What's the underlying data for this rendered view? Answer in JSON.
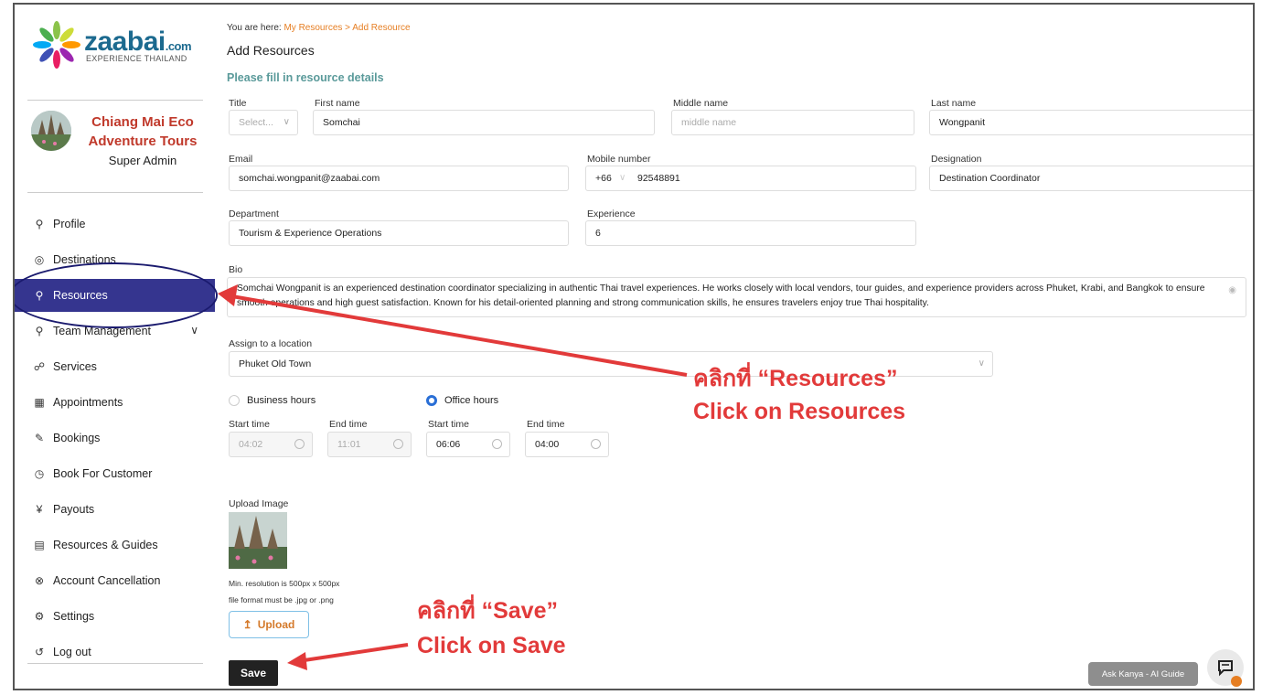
{
  "brand": {
    "name": "zaabai",
    "tld": ".com",
    "tagline": "EXPERIENCE THAILAND"
  },
  "org": {
    "name": "Chiang Mai Eco Adventure Tours",
    "role": "Super Admin"
  },
  "sidebar": {
    "items": [
      {
        "label": "Profile",
        "icon": "user-icon"
      },
      {
        "label": "Destinations",
        "icon": "location-icon"
      },
      {
        "label": "Resources",
        "icon": "user-icon",
        "active": true
      },
      {
        "label": "Team Management",
        "icon": "team-icon"
      },
      {
        "label": "Services",
        "icon": "services-icon"
      },
      {
        "label": "Appointments",
        "icon": "calendar-icon"
      },
      {
        "label": "Bookings",
        "icon": "edit-icon"
      },
      {
        "label": "Book For Customer",
        "icon": "clock-icon"
      },
      {
        "label": "Payouts",
        "icon": "currency-icon"
      },
      {
        "label": "Resources & Guides",
        "icon": "guide-icon"
      },
      {
        "label": "Account Cancellation",
        "icon": "cancel-icon"
      },
      {
        "label": "Settings",
        "icon": "gear-icon"
      },
      {
        "label": "Log out",
        "icon": "logout-icon"
      }
    ]
  },
  "breadcrumb": {
    "prefix": "You are here:",
    "link1": "My Resources",
    "sep": " >",
    "link2": "Add Resource"
  },
  "page": {
    "title": "Add Resources",
    "section": "Please fill in resource details"
  },
  "form": {
    "title_label": "Title",
    "title_placeholder": "Select...",
    "first_name_label": "First name",
    "first_name": "Somchai",
    "middle_name_label": "Middle name",
    "middle_name_placeholder": "middle name",
    "last_name_label": "Last name",
    "last_name": "Wongpanit",
    "email_label": "Email",
    "email": "somchai.wongpanit@zaabai.com",
    "mobile_label": "Mobile number",
    "country_code": "+66",
    "mobile": "92548891",
    "designation_label": "Designation",
    "designation": "Destination Coordinator",
    "department_label": "Department",
    "department": "Tourism & Experience Operations",
    "experience_label": "Experience",
    "experience": "6",
    "bio_label": "Bio",
    "bio": "Somchai Wongpanit is an experienced destination coordinator specializing in authentic Thai travel experiences. He works closely with local vendors, tour guides, and experience providers across Phuket, Krabi, and Bangkok to ensure smooth operations and high guest satisfaction. Known for his detail-oriented planning and strong communication skills, he ensures travelers enjoy true Thai hospitality.",
    "location_label": "Assign to a location",
    "location": "Phuket Old Town",
    "business_hours_label": "Business hours",
    "office_hours_label": "Office hours",
    "start_time_label": "Start time",
    "end_time_label": "End time",
    "business_start": "04:02",
    "business_end": "11:01",
    "office_start": "06:06",
    "office_end": "04:00",
    "upload_label": "Upload Image",
    "hint_resolution": "Min. resolution is 500px x 500px",
    "hint_format": "file format must be .jpg or .png",
    "upload_button": "Upload",
    "save_button": "Save"
  },
  "annotations": {
    "resources_th": "คลิกที่ “Resources”",
    "resources_en": "Click on Resources",
    "save_th": "คลิกที่ “Save”",
    "save_en": "Click on Save"
  },
  "assistant": {
    "label": "Ask Kanya - AI Guide"
  },
  "colors": {
    "accent": "#35358f",
    "annotation": "#e23a3a",
    "brand": "#1c6a8f",
    "org": "#c0392b",
    "upload": "#d4792a"
  }
}
